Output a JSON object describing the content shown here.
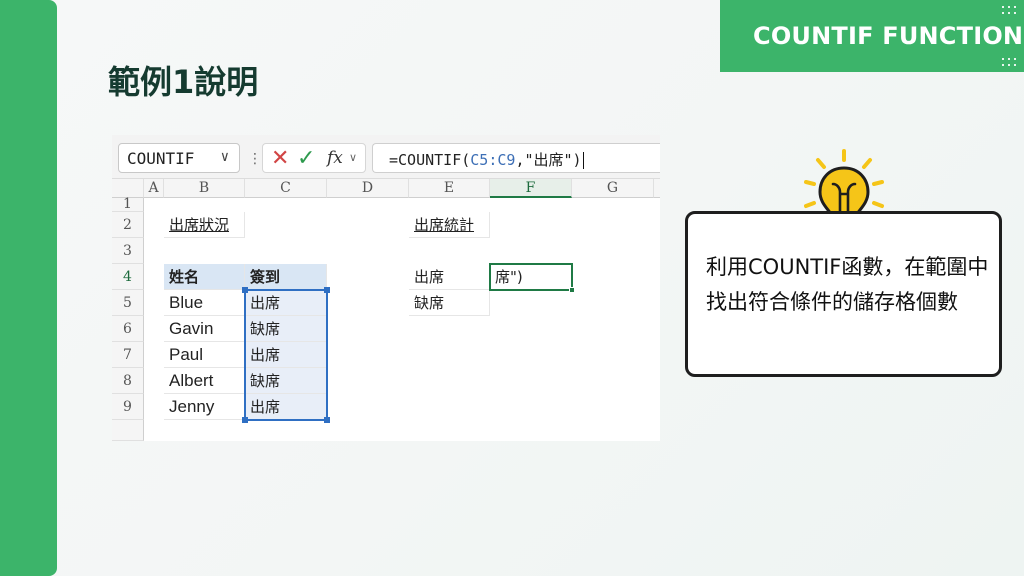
{
  "slide": {
    "title": "範例1說明",
    "badge": "COUNTIF FUNCTION",
    "note": "利用COUNTIF函數，在範圍中找出符合條件的儲存格個數"
  },
  "formula_bar": {
    "name_box": "COUNTIF",
    "formula_prefix": "=COUNTIF(",
    "formula_ref": "C5:C9",
    "formula_suffix": ",\"出席\")",
    "fx_label": "fx"
  },
  "sheet": {
    "columns": [
      "A",
      "B",
      "C",
      "D",
      "E",
      "F",
      "G"
    ],
    "rows": [
      "1",
      "2",
      "3",
      "4",
      "5",
      "6",
      "7",
      "8",
      "9"
    ],
    "B2": "出席狀況",
    "E2": "出席統計",
    "B4": "姓名",
    "C4": "簽到",
    "E4": "出席",
    "F4": "席\")",
    "E5": "缺席",
    "names": [
      "Blue",
      "Gavin",
      "Paul",
      "Albert",
      "Jenny"
    ],
    "status": [
      "出席",
      "缺席",
      "出席",
      "缺席",
      "出席"
    ]
  },
  "colors": {
    "accent_green": "#3cb46a",
    "title_color": "#153b30",
    "selection_blue": "#2f6fc3"
  }
}
